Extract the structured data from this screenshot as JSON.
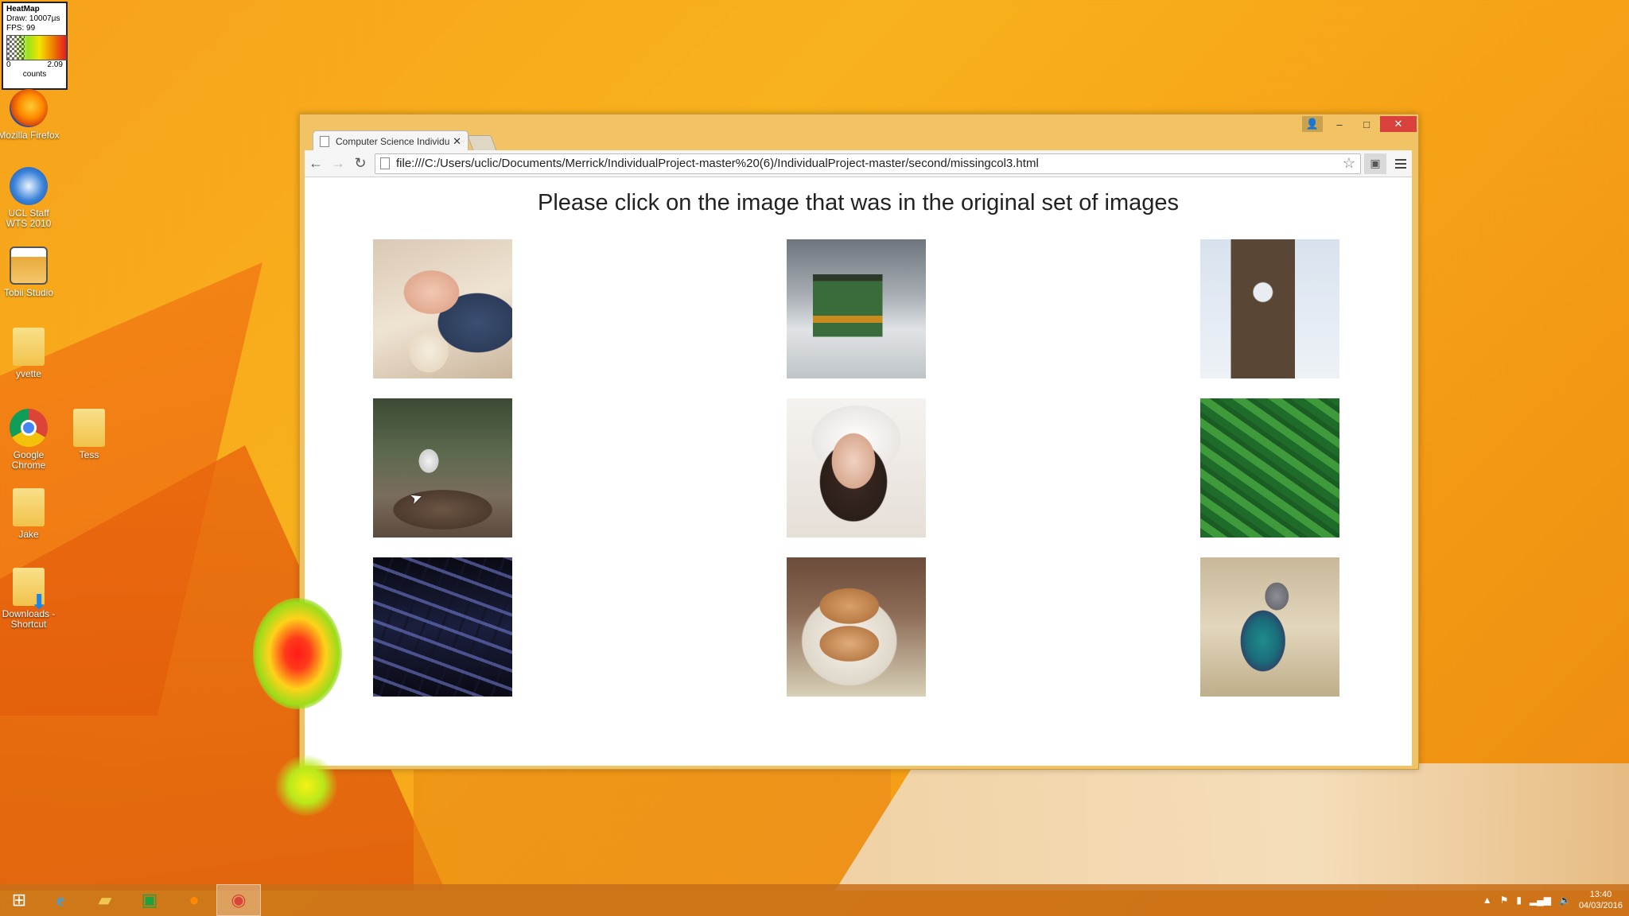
{
  "heatmap": {
    "title": "HeatMap",
    "draw": "Draw: 10007µs",
    "fps": "FPS: 99",
    "min": "0",
    "max": "2.09",
    "unit": "counts"
  },
  "desktop_icons": [
    {
      "label": "Mozilla Firefox",
      "icon": "firefox-icon"
    },
    {
      "label": "UCL Staff WTS 2010",
      "icon": "remote-desktop-icon"
    },
    {
      "label": "Tobii Studio",
      "icon": "tobii-studio-icon"
    },
    {
      "label": "yvette",
      "icon": "folder-icon"
    },
    {
      "label": "Google Chrome",
      "icon": "chrome-icon"
    },
    {
      "label": "Tess",
      "icon": "folder-icon"
    },
    {
      "label": "Jake",
      "icon": "folder-icon"
    },
    {
      "label": "Downloads - Shortcut",
      "icon": "downloads-folder-icon"
    }
  ],
  "browser": {
    "tab_title": "Computer Science Individu",
    "url": "file:///C:/Users/uclic/Documents/Merrick/IndividualProject-master%20(6)/IndividualProject-master/second/missingcol3.html",
    "window_controls": {
      "minimize": "–",
      "maximize": "□",
      "close": "✕"
    }
  },
  "page": {
    "title": "Please click on the image that was in the original set of images",
    "images": [
      {
        "name": "sleeping-baby"
      },
      {
        "name": "train"
      },
      {
        "name": "clock-tower"
      },
      {
        "name": "headphones-on-path"
      },
      {
        "name": "woman-in-winter-hood"
      },
      {
        "name": "cucumbers"
      },
      {
        "name": "keyboard"
      },
      {
        "name": "hot-dogs"
      },
      {
        "name": "pigeon"
      }
    ]
  },
  "taskbar": {
    "items": [
      "start",
      "internet-explorer",
      "file-explorer",
      "store",
      "firefox",
      "chrome"
    ],
    "clock_time": "13:40",
    "clock_date": "04/03/2016"
  }
}
